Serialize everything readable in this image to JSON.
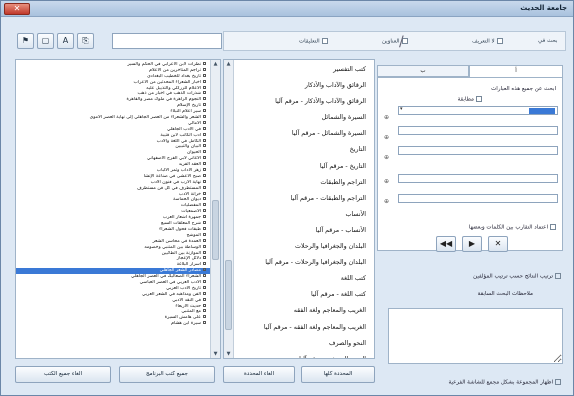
{
  "window": {
    "title": "جامعة الحديث"
  },
  "toolbar": {
    "buttons": [
      "⚑",
      "▢",
      "A",
      "⎘"
    ],
    "search_value": ""
  },
  "options": {
    "search_in": "بحث في",
    "option1": "لا التعريف",
    "option2": "العناوين",
    "option3": "التعليقات"
  },
  "tree": [
    {
      "label": "نظرات لابن الأعرابي في الحكم والسير",
      "selected": false
    },
    {
      "label": "تراجم المتأخرين من الأعلام",
      "selected": false
    },
    {
      "label": "تاريخ بغداد للخطيب البغدادي",
      "selected": false
    },
    {
      "label": "أخبار الشعراء المحدثين من الأعراب",
      "selected": false
    },
    {
      "label": "الأعلام للزركلي والتذييل عليه",
      "selected": false
    },
    {
      "label": "شذرات الذهب في أخبار من ذهب",
      "selected": false
    },
    {
      "label": "النجوم الزاهرة في ملوك مصر والقاهرة",
      "selected": false
    },
    {
      "label": "تاريخ الإسلام",
      "selected": false
    },
    {
      "label": "سير أعلام النبلاء",
      "selected": false
    },
    {
      "label": "الشعر والشعراء من العصر الجاهلي إلى نهاية العصر الأموي",
      "selected": false
    },
    {
      "label": "الأمالي",
      "selected": false
    },
    {
      "label": "في الأدب الجاهلي",
      "selected": false
    },
    {
      "label": "أدب الكاتب لابن قتيبة",
      "selected": false
    },
    {
      "label": "الكامل في اللغة والأدب",
      "selected": false
    },
    {
      "label": "البيان والتبيين",
      "selected": false
    },
    {
      "label": "الحيوان",
      "selected": false
    },
    {
      "label": "الأغاني لأبي الفرج الأصفهاني",
      "selected": false
    },
    {
      "label": "العقد الفريد",
      "selected": false
    },
    {
      "label": "زهر الآداب وثمر الألباب",
      "selected": false
    },
    {
      "label": "صبح الأعشى في صناعة الإنشا",
      "selected": false
    },
    {
      "label": "نهاية الأرب في فنون الأدب",
      "selected": false
    },
    {
      "label": "المستطرف في كل فن مستظرف",
      "selected": false
    },
    {
      "label": "خزانة الأدب",
      "selected": false
    },
    {
      "label": "ديوان الحماسة",
      "selected": false
    },
    {
      "label": "المفضليات",
      "selected": false
    },
    {
      "label": "الأصمعيات",
      "selected": false
    },
    {
      "label": "جمهرة أشعار العرب",
      "selected": false
    },
    {
      "label": "شرح المعلقات السبع",
      "selected": false
    },
    {
      "label": "طبقات فحول الشعراء",
      "selected": false
    },
    {
      "label": "الموشح",
      "selected": false
    },
    {
      "label": "العمدة في محاسن الشعر",
      "selected": false
    },
    {
      "label": "الوساطة بين المتنبي وخصومه",
      "selected": false
    },
    {
      "label": "الموازنة بين الطائيين",
      "selected": false
    },
    {
      "label": "دلائل الإعجاز",
      "selected": false
    },
    {
      "label": "أسرار البلاغة",
      "selected": false
    },
    {
      "label": "مصادر الشعر الجاهلي",
      "selected": true
    },
    {
      "label": "الشعراء الصعاليك في العصر الجاهلي",
      "selected": false
    },
    {
      "label": "الأدب العربي في العصر العباسي",
      "selected": false
    },
    {
      "label": "تاريخ الأدب العربي",
      "selected": false
    },
    {
      "label": "الفن ومذاهبه في الشعر العربي",
      "selected": false
    },
    {
      "label": "في النقد الأدبي",
      "selected": false
    },
    {
      "label": "حديث الأربعاء",
      "selected": false
    },
    {
      "label": "مع المتنبي",
      "selected": false
    },
    {
      "label": "على هامش السيرة",
      "selected": false
    },
    {
      "label": "سيرة ابن هشام",
      "selected": false
    }
  ],
  "categories": [
    {
      "label": "كتب التفسير",
      "selected": false
    },
    {
      "label": "الرقائق والآداب والأذكار",
      "selected": false
    },
    {
      "label": "الرقائق والآداب والأذكار - مرقم آليا",
      "selected": false
    },
    {
      "label": "السيرة والشمائل",
      "selected": false
    },
    {
      "label": "السيرة والشمائل - مرقم آليا",
      "selected": false
    },
    {
      "label": "التاريخ",
      "selected": false
    },
    {
      "label": "التاريخ - مرقم آليا",
      "selected": false
    },
    {
      "label": "التراجم والطبقات",
      "selected": false
    },
    {
      "label": "التراجم والطبقات - مرقم آليا",
      "selected": false
    },
    {
      "label": "الأنساب",
      "selected": false
    },
    {
      "label": "الأنساب - مرقم آليا",
      "selected": false
    },
    {
      "label": "البلدان والجغرافيا والرحلات",
      "selected": false
    },
    {
      "label": "البلدان والجغرافيا والرحلات - مرقم آليا",
      "selected": false
    },
    {
      "label": "كتب اللغة",
      "selected": false
    },
    {
      "label": "كتب اللغة - مرقم آليا",
      "selected": false
    },
    {
      "label": "الغريب والمعاجم ولغة الفقه",
      "selected": false
    },
    {
      "label": "الغريب والمعاجم ولغة الفقه - مرقم آليا",
      "selected": false
    },
    {
      "label": "النحو والصرف",
      "selected": false
    },
    {
      "label": "النحو والصرف - مرقم آليا",
      "selected": false
    },
    {
      "label": "الأدب والبلاغة",
      "selected": true
    }
  ],
  "bottom_buttons": {
    "left1": "الغاء جميع الكتب",
    "left2": "جميع كتب البرنامج",
    "mid1": "الغاء المحددة",
    "mid2": "المحددة كلها"
  },
  "form": {
    "tabs": [
      "أ",
      "ب"
    ],
    "search_all_label": "ابحث عن جميع هذه العبارات",
    "match_label": "مطابقة",
    "first_value": "مصادر",
    "distance_label": "اعتماد التقارب بين الكلمات وبعضها",
    "add_icon": "⊕",
    "dd_arrow": "▾",
    "nav": [
      "◀◀",
      "▶",
      "✕"
    ]
  },
  "extras": {
    "option_label": "ترتيب النتائج حسب ترتيب المؤلفين",
    "notes_label": "ملاحظات البحث السابقة",
    "bottom_check": "اظهار المجموعة بشكل مجمع للشاشة الفرعية"
  }
}
